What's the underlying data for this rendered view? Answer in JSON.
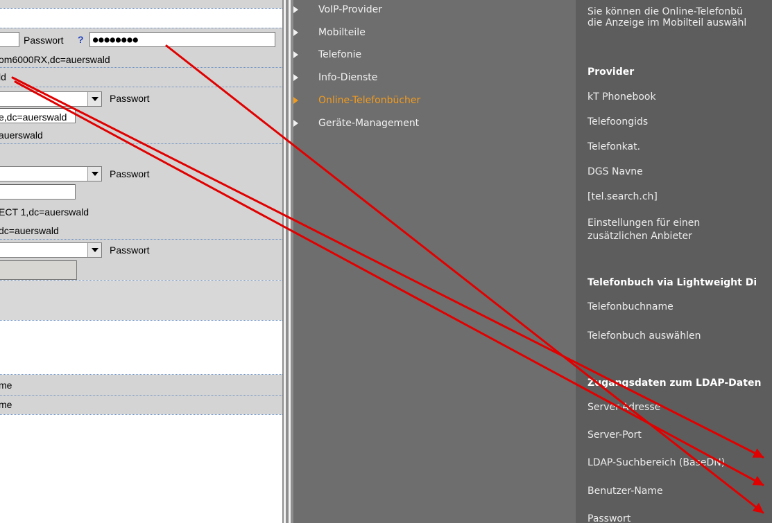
{
  "left_panel": {
    "password_label": "Passwort",
    "help_mark": "?",
    "password_value": "●●●●●●●●",
    "line1": "om6000RX,dc=auerswald",
    "line2": "ld",
    "row2_password_label": "Passwort",
    "line3": "e,dc=auerswald",
    "line4": "auerswald",
    "row3_password_label": "Passwort",
    "line5": "ECT 1,dc=auerswald",
    "line6": "dc=auerswald",
    "row4_password_label": "Passwort",
    "name1": "me",
    "name2": "me"
  },
  "nav": {
    "items": [
      {
        "label": "VoIP-Provider"
      },
      {
        "label": "Mobilteile"
      },
      {
        "label": "Telefonie"
      },
      {
        "label": "Info-Dienste"
      },
      {
        "label": "Online-Telefonbücher"
      },
      {
        "label": "Geräte-Management"
      }
    ]
  },
  "content": {
    "intro_line1": "Sie können die Online-Telefonbü",
    "intro_line2": "die Anzeige im Mobilteil auswähl",
    "provider_heading": "Provider",
    "providers": [
      "kT Phonebook",
      "Telefoongids",
      "Telefonkat.",
      "DGS Navne",
      "[tel.search.ch]"
    ],
    "extra_provider_line1": "Einstellungen für einen",
    "extra_provider_line2": "zusätzlichen Anbieter",
    "ldap_heading": "Telefonbuch via Lightweight Di",
    "phonebook_name": "Telefonbuchname",
    "select_phonebook": "Telefonbuch auswählen",
    "access_heading": "Zugangsdaten zum LDAP-Daten",
    "server_address": "Server-Adresse",
    "server_port": "Server-Port",
    "search_base": "LDAP-Suchbereich (BaseDN)",
    "user_name": "Benutzer-Name",
    "password": "Passwort"
  },
  "colors": {
    "active": "#f29c1f",
    "arrow": "#e00000"
  }
}
